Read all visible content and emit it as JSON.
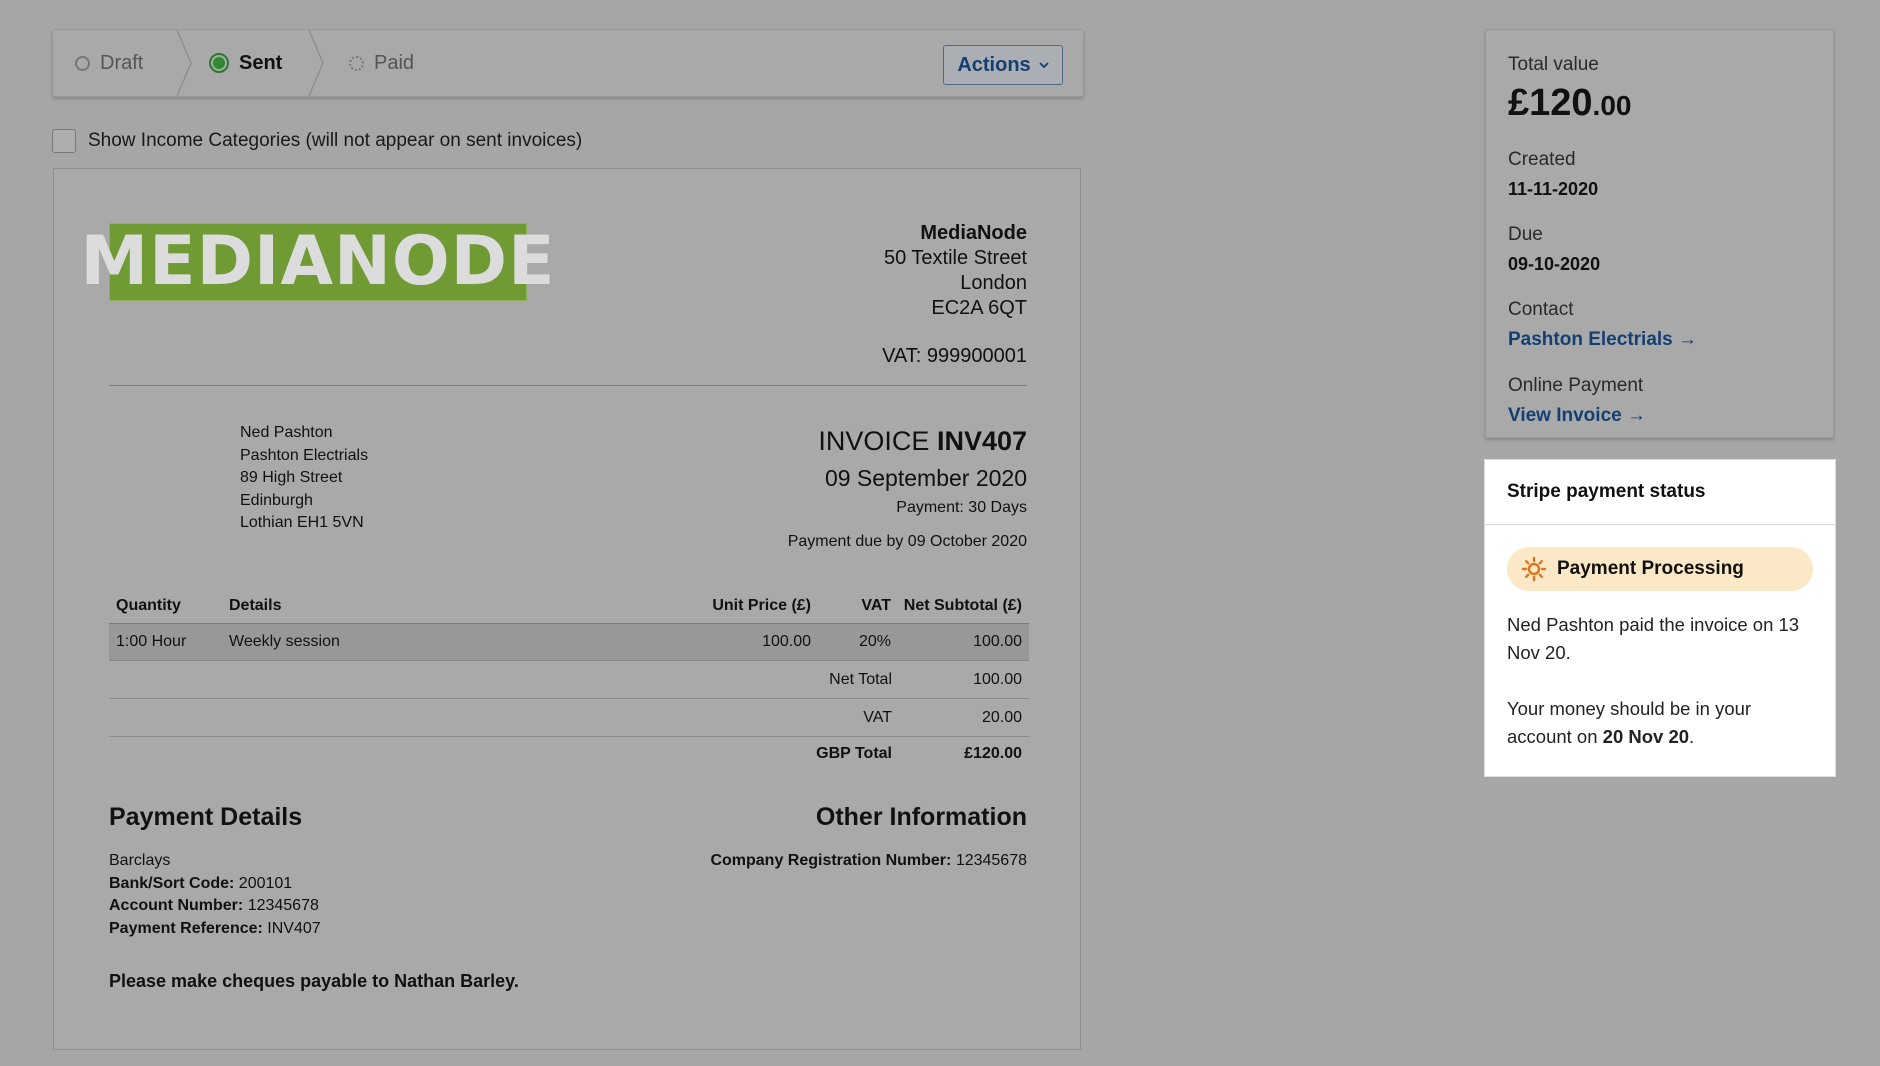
{
  "statusbar": {
    "steps": [
      {
        "label": "Draft",
        "state": "done"
      },
      {
        "label": "Sent",
        "state": "active"
      },
      {
        "label": "Paid",
        "state": "pending"
      }
    ],
    "actions_label": "Actions"
  },
  "income_toggle": {
    "label": "Show Income Categories (will not appear on sent invoices)",
    "checked": false
  },
  "invoice": {
    "logo_text": "MEDIANODE",
    "company": {
      "name": "MediaNode",
      "street": "50 Textile Street",
      "city": "London",
      "postcode": "EC2A 6QT",
      "vat": "VAT: 999900001"
    },
    "recipient": {
      "name": "Ned Pashton",
      "company": "Pashton Electrials",
      "street": "89 High Street",
      "city": "Edinburgh",
      "region": "Lothian EH1 5VN"
    },
    "title_prefix": "INVOICE",
    "number": "INV407",
    "date": "09 September 2020",
    "terms": "Payment: 30 Days",
    "due": "Payment due by 09 October 2020",
    "columns": {
      "quantity": "Quantity",
      "details": "Details",
      "unit_price": "Unit Price (£)",
      "vat": "VAT",
      "net_subtotal": "Net Subtotal (£)"
    },
    "line_items": [
      {
        "quantity": "1:00 Hour",
        "details": "Weekly session",
        "unit_price": "100.00",
        "vat": "20%",
        "net": "100.00"
      }
    ],
    "totals": {
      "net_label": "Net Total",
      "net_value": "100.00",
      "vat_label": "VAT",
      "vat_value": "20.00",
      "gbp_label": "GBP Total",
      "gbp_value": "£120.00"
    },
    "payment_details": {
      "heading": "Payment Details",
      "bank": "Barclays",
      "sort_label": "Bank/Sort Code:",
      "sort_value": "200101",
      "account_label": "Account Number:",
      "account_value": "12345678",
      "ref_label": "Payment Reference:",
      "ref_value": "INV407",
      "cheques": "Please make cheques payable to Nathan Barley."
    },
    "other_info": {
      "heading": "Other Information",
      "reg_label": "Company Registration Number:",
      "reg_value": "12345678"
    }
  },
  "summary": {
    "total_label": "Total value",
    "total_pounds": "£120",
    "total_pence": ".00",
    "created_label": "Created",
    "created_value": "11-11-2020",
    "due_label": "Due",
    "due_value": "09-10-2020",
    "contact_label": "Contact",
    "contact_link": "Pashton Electrials →",
    "online_label": "Online Payment",
    "online_link": "View Invoice →"
  },
  "stripe": {
    "heading": "Stripe payment status",
    "status": "Payment Processing",
    "status_icon": "sun-icon",
    "status_color": "#fbe8c6",
    "paid_text": "Ned Pashton paid the invoice on 13 Nov 20.",
    "money_text_prefix": "Your money should be in your account on ",
    "money_date": "20 Nov 20",
    "money_text_suffix": "."
  },
  "colors": {
    "accent": "#123f74",
    "active_green": "#2f8a2f",
    "logo_green": "#6f9a34",
    "overlay_gray": "#a6a6a6"
  }
}
